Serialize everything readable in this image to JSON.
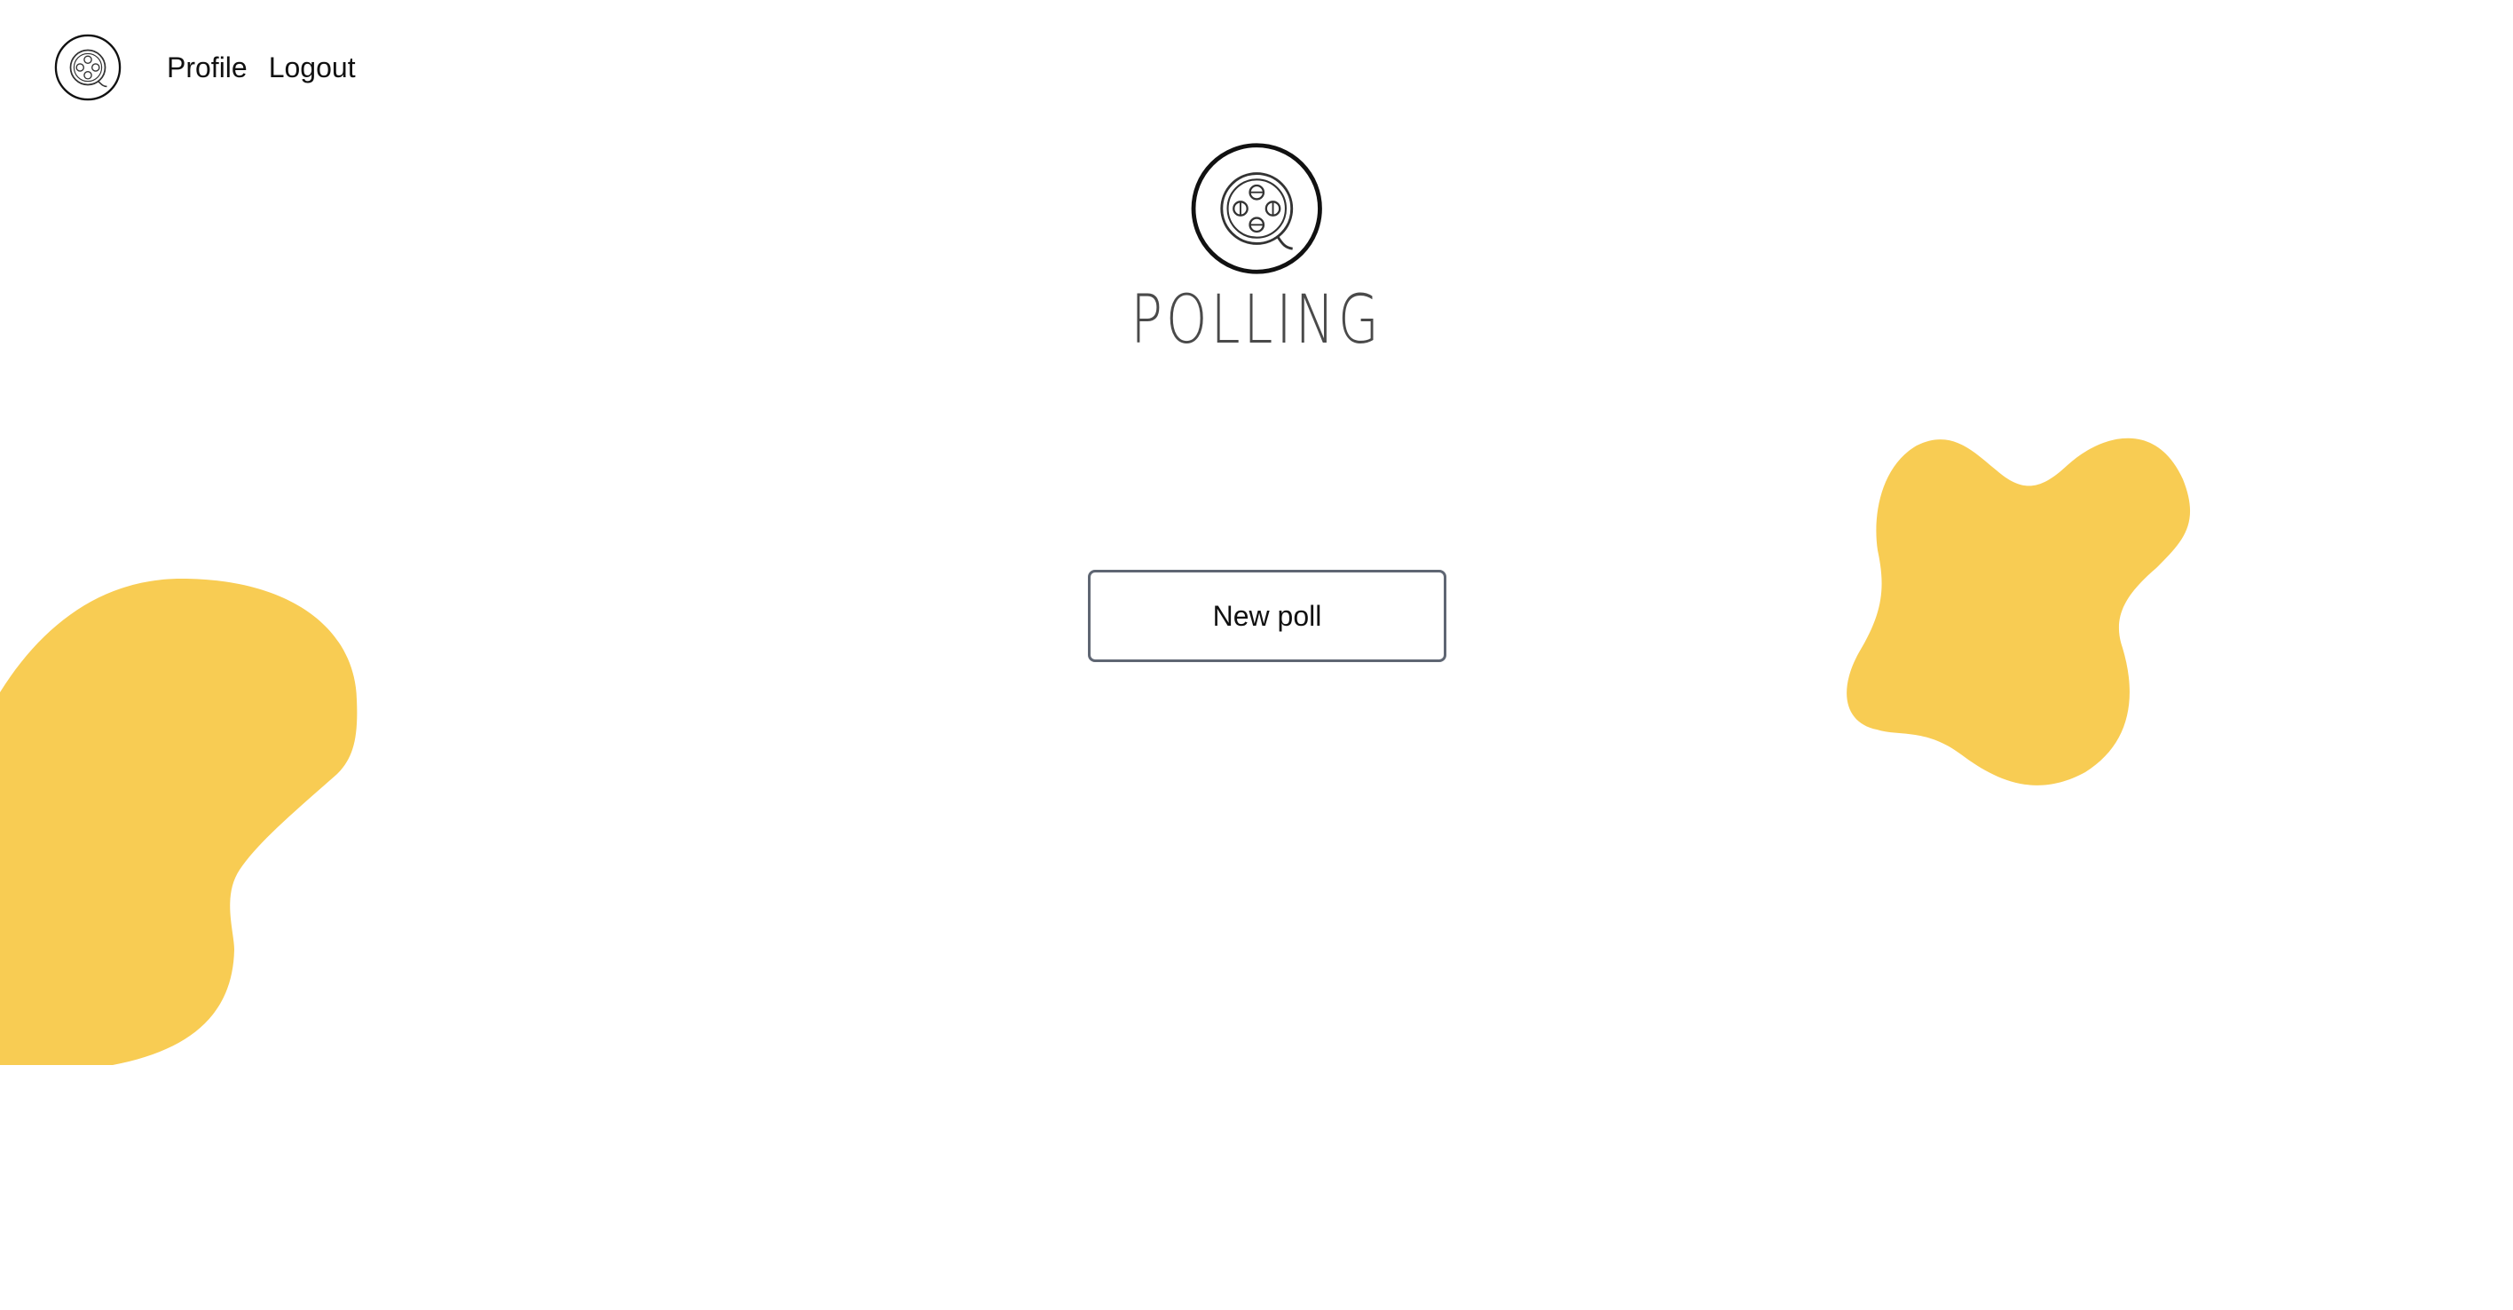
{
  "nav": {
    "logo_icon": "film-reel-logo-icon",
    "links": [
      {
        "label": "Profile"
      },
      {
        "label": "Logout"
      }
    ]
  },
  "brand": {
    "emblem_icon": "film-reel-emblem-icon",
    "wordmark": "POLLING"
  },
  "actions": {
    "new_poll_label": "New poll"
  },
  "colors": {
    "blob_fill": "#F8CC53",
    "button_border": "#5F6673",
    "text": "#111111",
    "background": "#FFFFFF"
  }
}
